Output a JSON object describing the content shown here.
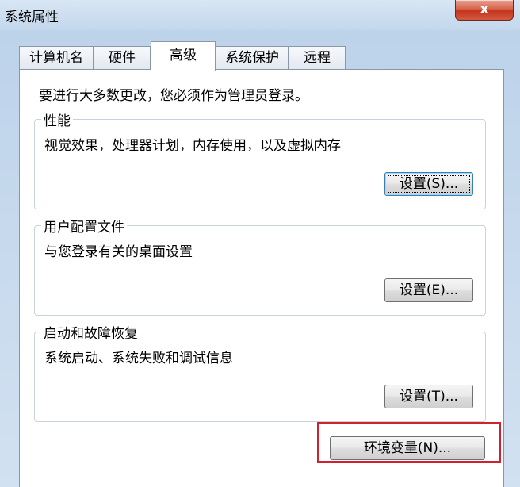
{
  "window": {
    "title": "系统属性",
    "close_label": "x"
  },
  "tabs": [
    {
      "label": "计算机名",
      "active": false
    },
    {
      "label": "硬件",
      "active": false
    },
    {
      "label": "高级",
      "active": true
    },
    {
      "label": "系统保护",
      "active": false
    },
    {
      "label": "远程",
      "active": false
    }
  ],
  "panel": {
    "admin_note": "要进行大多数更改，您必须作为管理员登录。",
    "groups": [
      {
        "title": "性能",
        "description": "视觉效果，处理器计划，内存使用，以及虚拟内存",
        "button": "设置(S)..."
      },
      {
        "title": "用户配置文件",
        "description": "与您登录有关的桌面设置",
        "button": "设置(E)..."
      },
      {
        "title": "启动和故障恢复",
        "description": "系统启动、系统失败和调试信息",
        "button": "设置(T)..."
      }
    ],
    "env_button": "环境变量(N)..."
  },
  "colors": {
    "highlight": "#d2202e",
    "close_button": "#c2351c"
  }
}
